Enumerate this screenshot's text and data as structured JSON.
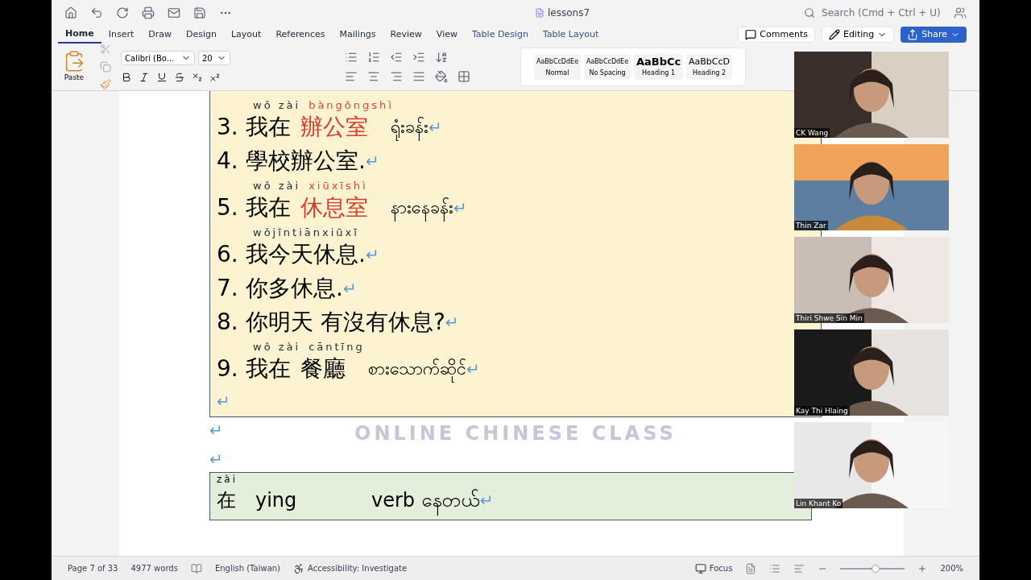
{
  "title_bar": {
    "document": "lessons7",
    "search_placeholder": "Search (Cmd + Ctrl + U)"
  },
  "tabs": [
    {
      "label": "Home",
      "selected": true,
      "kind": "main"
    },
    {
      "label": "Insert",
      "selected": false,
      "kind": "main"
    },
    {
      "label": "Draw",
      "selected": false,
      "kind": "main"
    },
    {
      "label": "Design",
      "selected": false,
      "kind": "main"
    },
    {
      "label": "Layout",
      "selected": false,
      "kind": "main"
    },
    {
      "label": "References",
      "selected": false,
      "kind": "main"
    },
    {
      "label": "Mailings",
      "selected": false,
      "kind": "main"
    },
    {
      "label": "Review",
      "selected": false,
      "kind": "main"
    },
    {
      "label": "View",
      "selected": false,
      "kind": "main"
    },
    {
      "label": "Table Design",
      "selected": false,
      "kind": "context"
    },
    {
      "label": "Table Layout",
      "selected": false,
      "kind": "context"
    }
  ],
  "actions": {
    "comments": "Comments",
    "editing": "Editing",
    "share": "Share"
  },
  "ribbon": {
    "paste": "Paste",
    "font": "Calibri (Bo...",
    "size": "20",
    "styles": [
      {
        "sample": "AaBbCcDdEe",
        "name": "Normal",
        "kind": "small"
      },
      {
        "sample": "AaBbCcDdEe",
        "name": "No Spacing",
        "kind": "small"
      },
      {
        "sample": "AaBbCc",
        "name": "Heading 1",
        "kind": "h1"
      },
      {
        "sample": "AaBbCcD",
        "name": "Heading 2",
        "kind": "h2"
      }
    ]
  },
  "document": {
    "mark": "↵",
    "watermark": "ONLINE CHINESE CLASS",
    "lines": [
      {
        "number": "3.",
        "pinyin": [
          {
            "text": "wǒ zài",
            "red": false
          },
          {
            "text": "bàngōngshì",
            "red": true
          }
        ],
        "parts": [
          {
            "text": "我在",
            "red": false
          },
          {
            "text": "辦公室",
            "red": true
          }
        ],
        "burmese": "ရုံးခန်း"
      },
      {
        "number": "4.",
        "parts": [
          {
            "text": "學校辦公室.",
            "red": false
          }
        ]
      },
      {
        "number": "5.",
        "pinyin": [
          {
            "text": "wǒ zài",
            "red": false
          },
          {
            "text": "xiūxīshì",
            "red": true
          }
        ],
        "parts": [
          {
            "text": "我在",
            "red": false
          },
          {
            "text": "休息室",
            "red": true
          }
        ],
        "burmese": "နားနေခန်း"
      },
      {
        "number": "6.",
        "pinyin": [
          {
            "text": "wǒjīntiānxiūxī",
            "red": false
          }
        ],
        "parts": [
          {
            "text": "我今天休息.",
            "red": false
          }
        ]
      },
      {
        "number": "7.",
        "parts": [
          {
            "text": "你多休息.",
            "red": false
          }
        ]
      },
      {
        "number": "8.",
        "parts": [
          {
            "text": "你明天 有沒有休息?",
            "red": false
          }
        ]
      },
      {
        "number": "9.",
        "pinyin": [
          {
            "text": "wǒ zài",
            "red": false
          },
          {
            "text": "cāntīng",
            "red": false
          }
        ],
        "parts": [
          {
            "text": "我在",
            "red": false
          },
          {
            "text": "餐廳",
            "red": false
          }
        ],
        "burmese": "စားသောက်ဆိုင်"
      }
    ],
    "next": {
      "pinyin": "zài",
      "hanzi": "在",
      "word": "ying",
      "meaning": "verb နေတယ်"
    }
  },
  "participants": [
    {
      "name": "CK Wang"
    },
    {
      "name": "Thin Zar"
    },
    {
      "name": "Thiri Shwe Sin Min"
    },
    {
      "name": "Kay Thi Hlaing"
    },
    {
      "name": "Lin Khant Ko"
    }
  ],
  "status_bar": {
    "page": "Page 7 of 33",
    "words": "4977 words",
    "language": "English (Taiwan)",
    "accessibility": "Accessibility: Investigate",
    "focus": "Focus",
    "zoom": "200%",
    "zoom_slider": {
      "level": 0.55
    }
  }
}
